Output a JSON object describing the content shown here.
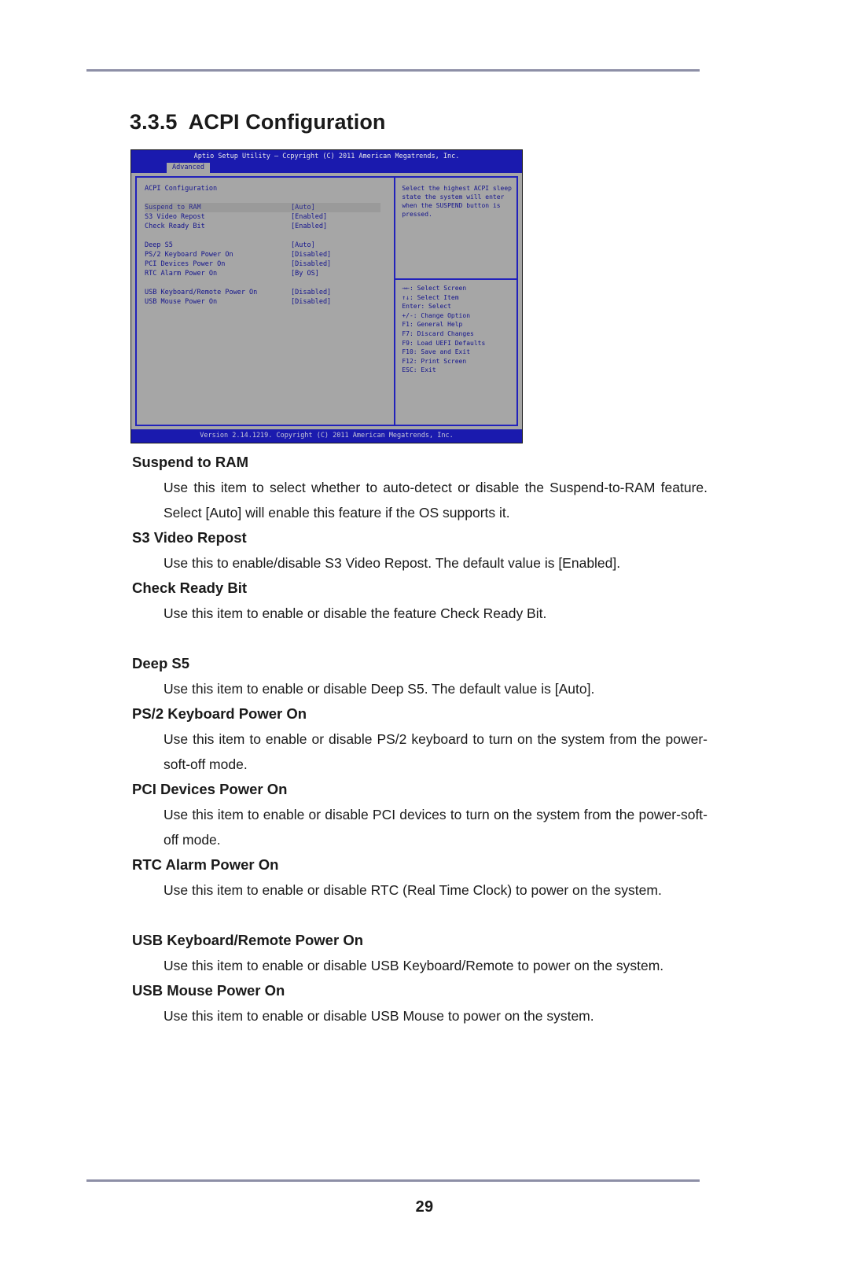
{
  "document": {
    "page_number": "29",
    "section_heading": "3.3.5  ACPI Configuration"
  },
  "bios": {
    "title": "Aptio Setup Utility – Ccpyright (C) 2011 American Megatrends, Inc.",
    "active_tab": "Advanced",
    "panel_title": "ACPI Configuration",
    "version_bar": "Version 2.14.1219. Copyright (C) 2011 American Megatrends, Inc.",
    "items": [
      {
        "label": "Suspend to RAM",
        "value": "[Auto]",
        "selected": true
      },
      {
        "label": "S3 Video Repost",
        "value": "[Enabled]",
        "selected": false
      },
      {
        "label": "Check Ready Bit",
        "value": "[Enabled]",
        "selected": false
      },
      {
        "label": "",
        "value": "",
        "selected": false
      },
      {
        "label": "Deep S5",
        "value": "[Auto]",
        "selected": false
      },
      {
        "label": "PS/2 Keyboard Power On",
        "value": "[Disabled]",
        "selected": false
      },
      {
        "label": "PCI Devices Power On",
        "value": "[Disabled]",
        "selected": false
      },
      {
        "label": "RTC Alarm Power On",
        "value": "[By OS]",
        "selected": false
      },
      {
        "label": "",
        "value": "",
        "selected": false
      },
      {
        "label": "USB Keyboard/Remote Power On",
        "value": "[Disabled]",
        "selected": false
      },
      {
        "label": "USB Mouse Power On",
        "value": "[Disabled]",
        "selected": false
      }
    ],
    "help": [
      "Select the highest ACPI sleep",
      "state the system will enter",
      "when the SUSPEND button is",
      "pressed."
    ],
    "legend": [
      "→←: Select Screen",
      "↑↓: Select Item",
      "Enter: Select",
      "+/-: Change Option",
      "F1: General Help",
      "F7: Discard Changes",
      "F9: Load UEFI Defaults",
      "F10: Save and Exit",
      "F12: Print Screen",
      "ESC: Exit"
    ]
  },
  "entries": [
    {
      "term": "Suspend to RAM",
      "desc": "Use this item to select whether to auto-detect or disable the Suspend-to-RAM feature. Select [Auto] will enable this feature if the OS supports it.",
      "gap_before": false
    },
    {
      "term": "S3 Video Repost",
      "desc": "Use this to enable/disable S3 Video Repost. The default value is [Enabled].",
      "gap_before": false
    },
    {
      "term": "Check Ready Bit",
      "desc": "Use this item to enable or disable the feature Check Ready Bit.",
      "gap_before": false
    },
    {
      "term": "Deep S5",
      "desc": "Use this item to enable or disable Deep S5. The default value is [Auto].",
      "gap_before": true
    },
    {
      "term": "PS/2 Keyboard Power On",
      "desc": "Use this item to enable or disable PS/2 keyboard to turn on the system from the power-soft-off mode.",
      "gap_before": false
    },
    {
      "term": "PCI Devices Power On",
      "desc": "Use this item to enable or disable PCI devices to turn on the system from the power-soft-off mode.",
      "gap_before": false
    },
    {
      "term": "RTC Alarm Power On",
      "desc": "Use this item to enable or disable RTC (Real Time Clock) to power on the system.",
      "gap_before": false
    },
    {
      "term": "USB Keyboard/Remote Power On",
      "desc": "Use this item to enable or disable USB Keyboard/Remote to power on the system.",
      "gap_before": true
    },
    {
      "term": "USB Mouse Power On",
      "desc": "Use this item to enable or disable USB Mouse to power on the system.",
      "gap_before": false
    }
  ],
  "colors": {
    "bios_blue": "#1a1aae",
    "bios_gray": "#a6a6a6",
    "bios_text": "#14148c",
    "rule": "#8d8fa6"
  }
}
